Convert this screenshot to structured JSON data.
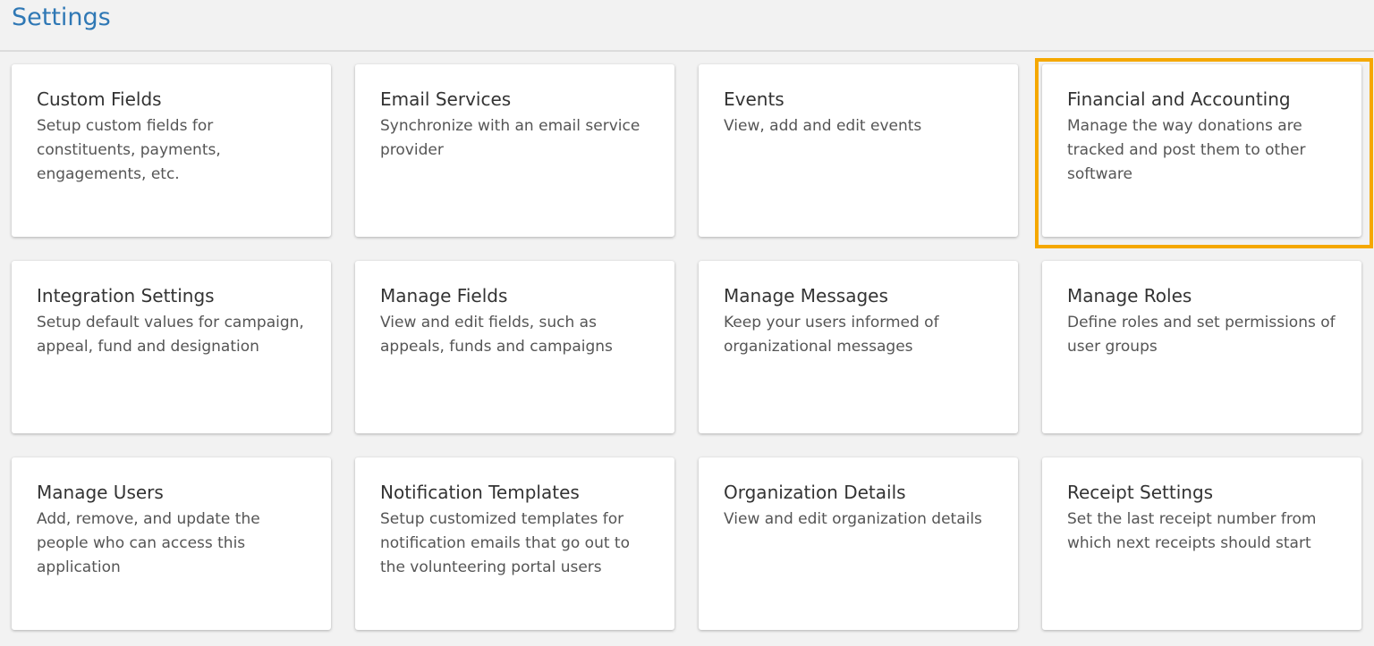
{
  "header": {
    "title": "Settings"
  },
  "colors": {
    "title": "#2f78b5",
    "highlight": "#f5a800",
    "background": "#f2f2f2"
  },
  "cards": [
    {
      "title": "Custom Fields",
      "description": "Setup custom fields for constituents, payments, engagements, etc."
    },
    {
      "title": "Email Services",
      "description": "Synchronize with an email service provider"
    },
    {
      "title": "Events",
      "description": "View, add and edit events"
    },
    {
      "title": "Financial and Accounting",
      "description": "Manage the way donations are tracked and post them to other software",
      "highlighted": true
    },
    {
      "title": "Integration Settings",
      "description": "Setup default values for campaign, appeal, fund and designation"
    },
    {
      "title": "Manage Fields",
      "description": "View and edit fields, such as appeals, funds and campaigns"
    },
    {
      "title": "Manage Messages",
      "description": "Keep your users informed of organizational messages"
    },
    {
      "title": "Manage Roles",
      "description": "Define roles and set permissions of user groups"
    },
    {
      "title": "Manage Users",
      "description": "Add, remove, and update the people who can access this application"
    },
    {
      "title": "Notification Templates",
      "description": "Setup customized templates for notification emails that go out to the volunteering portal users"
    },
    {
      "title": "Organization Details",
      "description": "View and edit organization details"
    },
    {
      "title": "Receipt Settings",
      "description": "Set the last receipt number from which next receipts should start"
    }
  ]
}
